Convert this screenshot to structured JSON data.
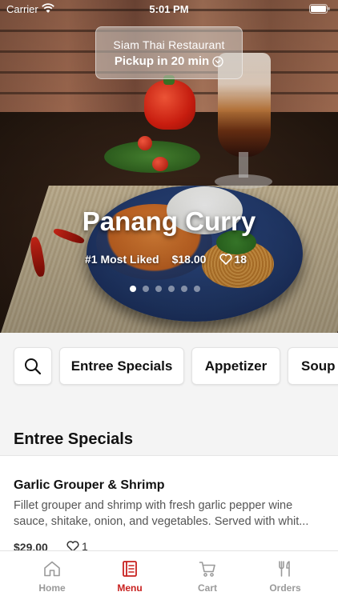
{
  "status_bar": {
    "carrier": "Carrier",
    "time": "5:01 PM"
  },
  "header": {
    "restaurant_name": "Siam Thai Restaurant",
    "pickup_label": "Pickup in 20 min"
  },
  "featured": {
    "dish_name": "Panang Curry",
    "rank_label": "#1 Most Liked",
    "price": "$18.00",
    "likes": "18",
    "pager": {
      "total": 6,
      "active_index": 0
    }
  },
  "categories": {
    "items": [
      "Entree Specials",
      "Appetizer",
      "Soup"
    ]
  },
  "section": {
    "title": "Entree Specials",
    "items": [
      {
        "name": "Garlic Grouper & Shrimp",
        "desc_line1": "Fillet grouper and shrimp with fresh garlic pepper wine",
        "desc_line2": "sauce, shitake, onion, and vegetables. Served with whit...",
        "price": "$29.00",
        "likes": "1"
      }
    ]
  },
  "tab_bar": {
    "tabs": [
      "Home",
      "Menu",
      "Cart",
      "Orders"
    ],
    "active": "Menu"
  },
  "colors": {
    "accent": "#c8211f",
    "inactive_tab": "#9a9a9a",
    "background_light": "#f4f4f4"
  },
  "icons": [
    "wifi-icon",
    "battery-icon",
    "chevron-circle-icon",
    "heart-icon",
    "search-icon",
    "home-icon",
    "menu-icon",
    "cart-icon",
    "orders-icon"
  ]
}
